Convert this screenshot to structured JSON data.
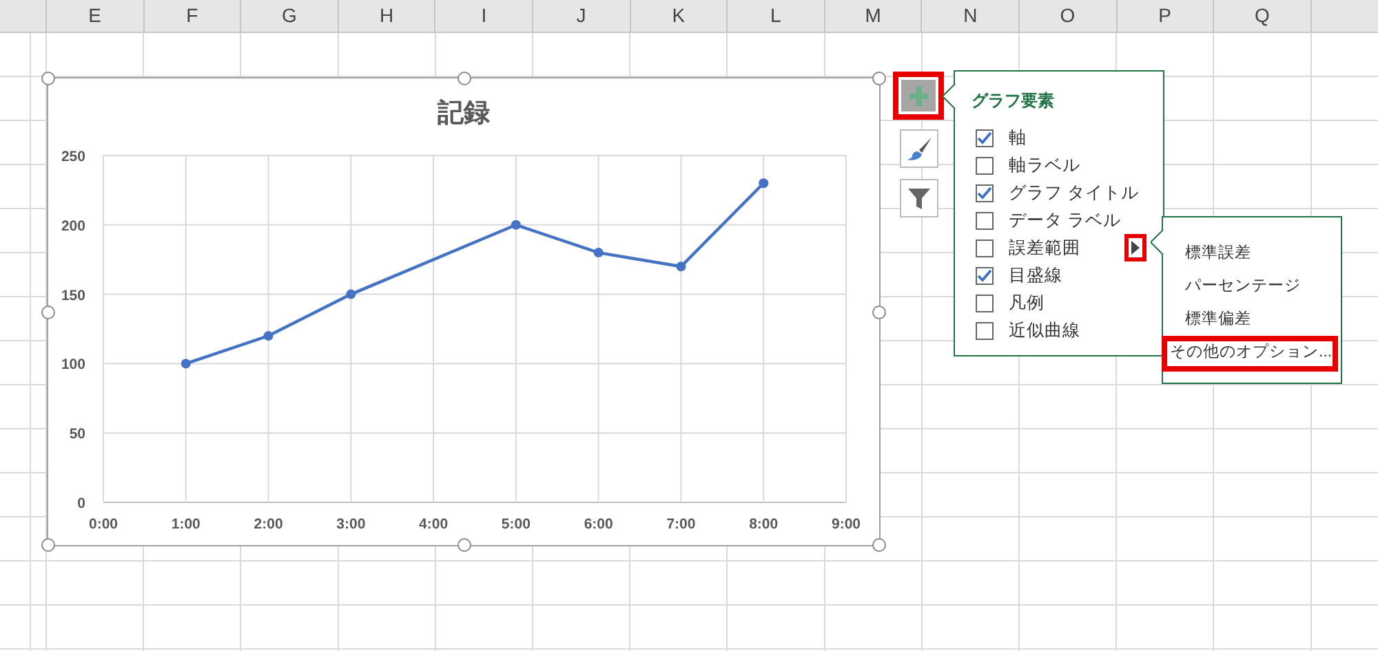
{
  "sheet": {
    "columns": [
      "E",
      "F",
      "G",
      "H",
      "I",
      "J",
      "K",
      "L",
      "M",
      "N",
      "O",
      "P",
      "Q"
    ]
  },
  "chart": {
    "selected": true,
    "chart_data": {
      "type": "line",
      "title": "記録",
      "x": [
        1,
        2,
        3,
        5,
        6,
        7,
        8
      ],
      "grid": true,
      "series": [
        {
          "color": "#4472c4",
          "marker": "circle",
          "values": [
            100,
            120,
            150,
            200,
            180,
            170,
            230
          ]
        }
      ],
      "xlim": [
        0,
        9
      ],
      "ylim": [
        0,
        250
      ],
      "xticks": [
        {
          "value": 0,
          "label": "0:00"
        },
        {
          "value": 1,
          "label": "1:00"
        },
        {
          "value": 2,
          "label": "2:00"
        },
        {
          "value": 3,
          "label": "3:00"
        },
        {
          "value": 4,
          "label": "4:00"
        },
        {
          "value": 5,
          "label": "5:00"
        },
        {
          "value": 6,
          "label": "6:00"
        },
        {
          "value": 7,
          "label": "7:00"
        },
        {
          "value": 8,
          "label": "8:00"
        },
        {
          "value": 9,
          "label": "9:00"
        }
      ],
      "yticks": [
        0,
        50,
        100,
        150,
        200,
        250
      ]
    }
  },
  "side_buttons": [
    {
      "kind": "elements",
      "highlighted": true
    },
    {
      "kind": "styles",
      "highlighted": false
    },
    {
      "kind": "filter",
      "highlighted": false
    }
  ],
  "chart_elements": {
    "title": "グラフ要素",
    "items": [
      {
        "label": "軸",
        "checked": true
      },
      {
        "label": "軸ラベル",
        "checked": false
      },
      {
        "label": "グラフ タイトル",
        "checked": true
      },
      {
        "label": "データ ラベル",
        "checked": false
      },
      {
        "label": "誤差範囲",
        "checked": false,
        "submenu": {
          "arrow_highlighted": true,
          "items": [
            {
              "label": "標準誤差",
              "highlighted": false
            },
            {
              "label": "パーセンテージ",
              "highlighted": false
            },
            {
              "label": "標準偏差",
              "highlighted": false
            },
            {
              "label": "その他のオプション...",
              "highlighted": true
            }
          ]
        }
      },
      {
        "label": "目盛線",
        "checked": true
      },
      {
        "label": "凡例",
        "checked": false
      },
      {
        "label": "近似曲線",
        "checked": false
      }
    ]
  }
}
